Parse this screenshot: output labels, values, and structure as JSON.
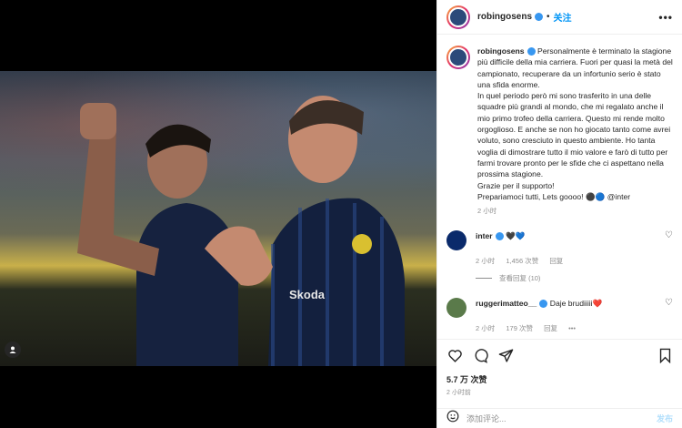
{
  "post": {
    "username": "robingosens",
    "follow_label": "关注",
    "more_label": "•••",
    "caption_lines": [
      "Personalmente è terminato la stagione più difficile della mia carriera. Fuori per quasi la metà del campionato, recuperare da un infortunio serio è stato una sfida enorme.",
      "In quel periodo però mi sono trasferito in una delle squadre più grandi al mondo, che mi regalato anche il mio primo trofeo della carriera. Questo mi rende molto orgoglioso. E anche se non ho giocato tanto come avrei voluto, sono cresciuto in questo ambiente. Ho tanta voglia di dimostrare tutto il mio valore e farò di tutto per farmi trovare pronto per le sfide che ci aspettano nella prossima stagione.",
      "Grazie per il supporto!",
      "Prepariamoci tutti, Lets goooo! ⚫🔵 @inter"
    ],
    "caption_time": "2 小时",
    "likes": "5.7 万 次赞",
    "time": "2 小时前"
  },
  "comments": [
    {
      "username": "inter",
      "text": "🖤💙",
      "time": "2 小时",
      "likes": "1,456 次赞",
      "reply": "回复",
      "view_replies": "查看回复 (10)",
      "avatar_color": "#0a2a6b"
    },
    {
      "username": "ruggerimatteo__",
      "text": "Daje brudiiiii❤️",
      "time": "2 小时",
      "likes": "179 次赞",
      "reply": "回复",
      "more": "•••",
      "avatar_color": "#5a7a4a"
    }
  ],
  "add_comment": {
    "placeholder": "添加评论...",
    "post_label": "发布"
  },
  "colors": {
    "accent": "#0095f6",
    "verified": "#3897f0"
  }
}
